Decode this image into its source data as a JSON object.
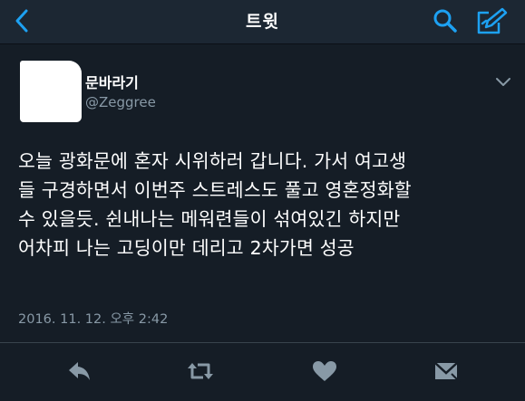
{
  "header": {
    "title": "트윗",
    "back_icon": "chevron-left-icon",
    "search_icon": "search-icon",
    "compose_icon": "compose-icon",
    "accent_color": "#1da1f2",
    "background_color": "#1c2733"
  },
  "tweet": {
    "display_name": "문바라기",
    "handle": "@Zeggree",
    "text_lines": [
      "오늘 광화문에 혼자 시위하러 갑니다. 가서 여고생",
      "들 구경하면서 이번주 스트레스도 풀고 영혼정화할",
      "수 있을듯. 쉰내나는 메워련들이 섞여있긴 하지만",
      "어차피 나는 고딩이만 데리고 2차가면 성공"
    ],
    "timestamp": "2016. 11. 12. 오후 2:42",
    "avatar_note_color": "#ffffff",
    "menu_icon": "chevron-down-icon"
  },
  "actions": [
    {
      "name": "reply",
      "icon": "reply-icon"
    },
    {
      "name": "retweet",
      "icon": "retweet-icon"
    },
    {
      "name": "like",
      "icon": "heart-icon"
    },
    {
      "name": "message",
      "icon": "direct-message-icon"
    }
  ],
  "colors": {
    "text_primary": "#ffffff",
    "text_secondary": "#8899a6",
    "icon_muted": "#8899a6",
    "page_background": "#151d26"
  }
}
